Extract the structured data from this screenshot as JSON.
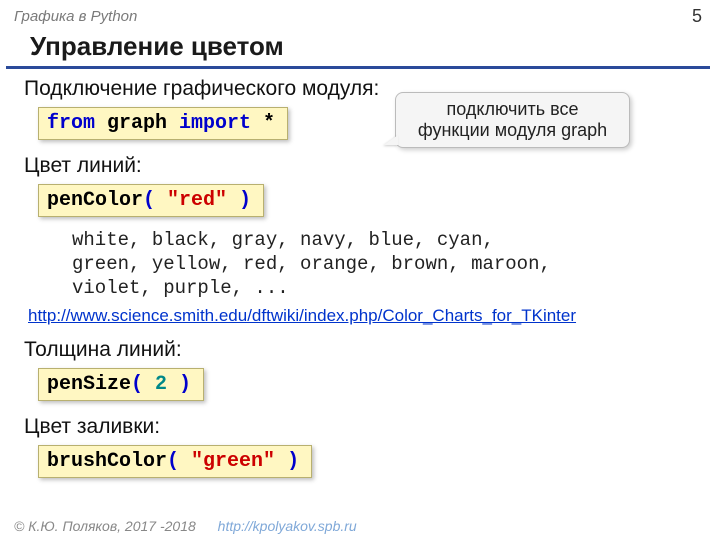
{
  "header": {
    "topic": "Графика в Python",
    "page": "5"
  },
  "title": "Управление цветом",
  "sections": {
    "import_label": "Подключение графического модуля:",
    "line_color_label": "Цвет линий:",
    "line_width_label": "Толщина линий:",
    "fill_color_label": "Цвет заливки:"
  },
  "code": {
    "import": {
      "kw_from": "from",
      "module": " graph ",
      "kw_import": "import",
      "star": " *"
    },
    "pencolor": {
      "fn": "penColor",
      "open": "( ",
      "arg": "\"red\"",
      "close": " )"
    },
    "pensize": {
      "fn": "penSize",
      "open": "( ",
      "arg": "2",
      "close": " )"
    },
    "brushcolor": {
      "fn": "brushColor",
      "open": "( ",
      "arg": "\"green\"",
      "close": " )"
    }
  },
  "callout": {
    "line1": "подключить все",
    "line2": "функции модуля graph"
  },
  "colors_text": "white, black, gray, navy, blue, cyan,\ngreen, yellow, red, orange, brown, maroon,\nviolet, purple, ...",
  "link": "http://www.science.smith.edu/dftwiki/index.php/Color_Charts_for_TKinter",
  "footer": {
    "copyright": "© К.Ю. Поляков, 2017 -2018",
    "site": "http://kpolyakov.spb.ru"
  }
}
